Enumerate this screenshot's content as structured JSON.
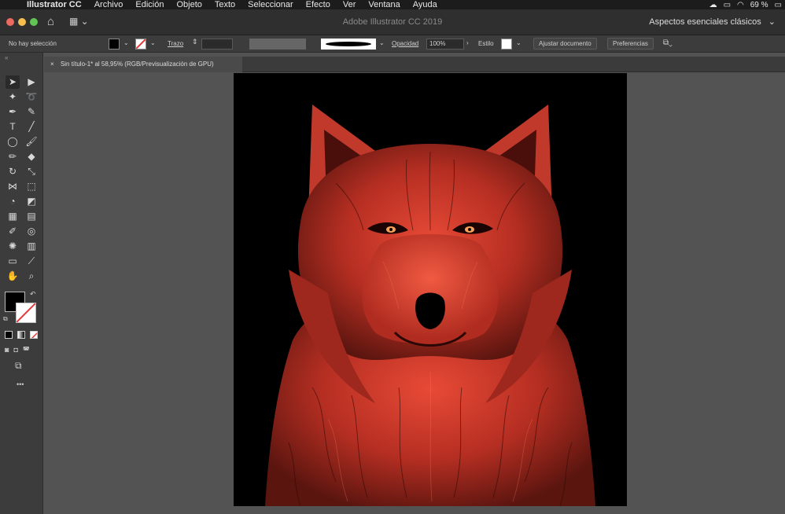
{
  "menubar": {
    "apple": "",
    "app_name": "Illustrator CC",
    "items": [
      "Archivo",
      "Edición",
      "Objeto",
      "Texto",
      "Seleccionar",
      "Efecto",
      "Ver",
      "Ventana",
      "Ayuda"
    ],
    "battery": "69 %"
  },
  "titlebar": {
    "title": "Adobe Illustrator CC 2019",
    "workspace": "Aspectos esenciales clásicos"
  },
  "control_bar": {
    "selection_status": "No hay selección",
    "stroke_label": "Trazo",
    "opacity_label": "Opacidad",
    "opacity_value": "100%",
    "style_label": "Estilo",
    "fit_document_button": "Ajustar documento",
    "preferences_button": "Preferencias"
  },
  "document": {
    "tab_title": "Sin título-1* al 58,95% (RGB/Previsualización de GPU)",
    "close_glyph": "×"
  },
  "colors": {
    "fill": "#000000",
    "stroke": "none",
    "wolf_red": "#d63a2a",
    "artboard_bg": "#000000"
  },
  "tools": {
    "icons": [
      "selection-icon",
      "direct-selection-icon",
      "magic-wand-icon",
      "lasso-icon",
      "pen-icon",
      "curvature-icon",
      "type-icon",
      "line-icon",
      "ellipse-icon",
      "paintbrush-icon",
      "shaper-icon",
      "eraser-icon",
      "rotate-icon",
      "scale-icon",
      "width-icon",
      "free-transform-icon",
      "shape-builder-icon",
      "perspective-icon",
      "mesh-icon",
      "gradient-icon",
      "eyedropper-icon",
      "blend-icon",
      "symbol-sprayer-icon",
      "graph-icon",
      "artboard-icon",
      "slice-icon",
      "hand-icon",
      "zoom-icon"
    ],
    "more": "•••"
  }
}
